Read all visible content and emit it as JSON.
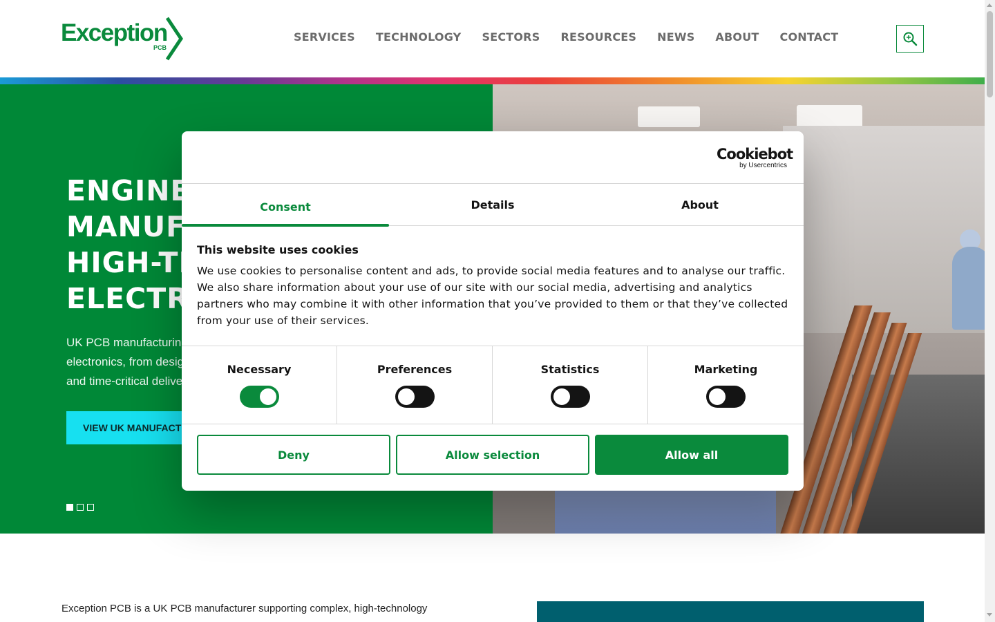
{
  "header": {
    "logo_text": "Exception",
    "logo_sub": "PCB",
    "nav": [
      "SERVICES",
      "TECHNOLOGY",
      "SECTORS",
      "RESOURCES",
      "NEWS",
      "ABOUT",
      "CONTACT"
    ]
  },
  "hero": {
    "title": "ENGINEERING &\nMANUFACTURING\nHIGH-TECHNOLOGY\nELECTRONICS",
    "description": "UK PCB manufacturing for high-technology\nelectronics, from design through to complex\nand time-critical delivery.",
    "cta_label": "VIEW UK MANUFACTURING",
    "slides": 3,
    "active_slide": 1
  },
  "intro_text": "Exception PCB is a UK PCB manufacturer supporting complex, high-technology",
  "cookie_dialog": {
    "brand": "Cookiebot",
    "brand_sub": "by Usercentrics",
    "tabs": [
      {
        "label": "Consent",
        "active": true
      },
      {
        "label": "Details",
        "active": false
      },
      {
        "label": "About",
        "active": false
      }
    ],
    "heading": "This website uses cookies",
    "body": "We use cookies to personalise content and ads, to provide social media features and to analyse our traffic. We also share information about your use of our site with our social media, advertising and analytics partners who may combine it with other information that you’ve provided to them or that they’ve collected from your use of their services.",
    "toggles": [
      {
        "label": "Necessary",
        "on": true
      },
      {
        "label": "Preferences",
        "on": false
      },
      {
        "label": "Statistics",
        "on": false
      },
      {
        "label": "Marketing",
        "on": false
      }
    ],
    "buttons": {
      "deny": "Deny",
      "allow_selection": "Allow selection",
      "allow_all": "Allow all"
    }
  },
  "colors": {
    "brand_green": "#0a8a3c",
    "hero_green": "#008837",
    "cta_cyan": "#17e0f0",
    "teal": "#005f6e"
  }
}
